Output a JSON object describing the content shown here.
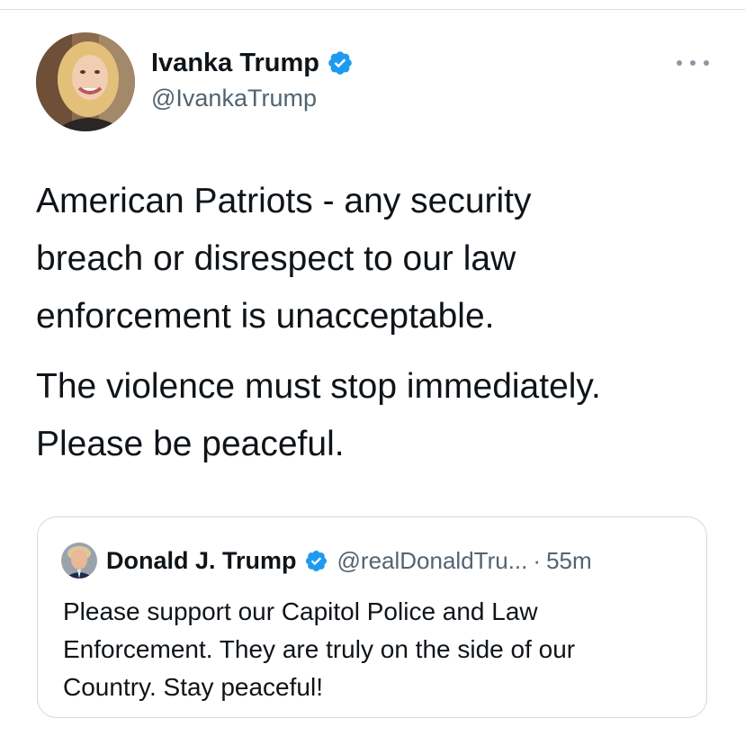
{
  "tweet": {
    "author": {
      "name": "Ivanka Trump",
      "handle": "@IvankaTrump",
      "verified": true
    },
    "text_paragraphs": [
      "American Patriots - any security\nbreach or disrespect to our law\nenforcement is unacceptable.",
      "The violence must stop immediately.\nPlease be peaceful."
    ],
    "more_icon": "more-horizontal-icon"
  },
  "quoted_tweet": {
    "author": {
      "name": "Donald J. Trump",
      "handle": "@realDonaldTru...",
      "verified": true
    },
    "separator": "·",
    "time": "55m",
    "text": "Please support our Capitol Police and Law\nEnforcement. They are truly on the side of our\nCountry. Stay peaceful!"
  },
  "colors": {
    "text_primary": "#0f1419",
    "text_secondary": "#536471",
    "verified_blue": "#1d9bf0",
    "border": "#cfd9de"
  }
}
